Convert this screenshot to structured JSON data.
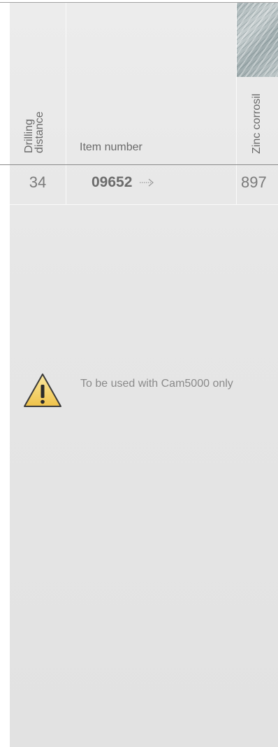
{
  "headers": {
    "drilling_distance": "Drilling distance",
    "item_number": "Item number",
    "zinc_corrosil": "Zinc corrosil"
  },
  "row": {
    "drilling_distance": "34",
    "item_number": "09652",
    "zinc_corrosil": "897"
  },
  "note": "To be used with Cam5000 only",
  "icons": {
    "warning": "warning-icon",
    "arrow": "dotted-arrow-icon",
    "swatch": "zinc-texture-swatch"
  },
  "colors": {
    "sheet": "#e6e6e6",
    "text": "#6a6a6a",
    "warning_fill": "#f3d66a",
    "swatch": "#b3bfc1"
  }
}
